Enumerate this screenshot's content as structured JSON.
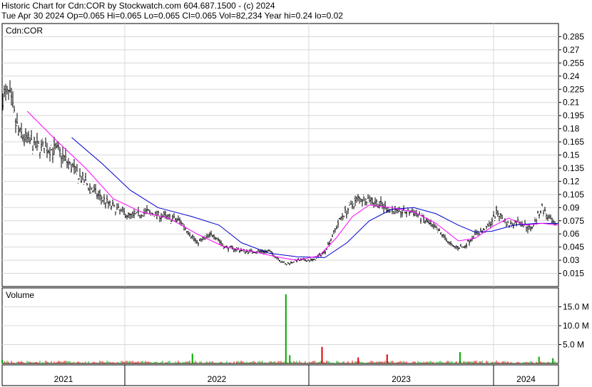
{
  "header": {
    "line1": "Historic Chart for Cdn:COR by Stockwatch.com 604.687.1500 - (c) 2024",
    "line2": "Tue Apr 30 2024  Op=0.065  Hi=0.065  Lo=0.065  Cl=0.065  Vol=82,234  Year hi=0.24  lo=0.02"
  },
  "colors": {
    "background": "#ffffff",
    "grid": "#d8d8d8",
    "price_bars": "#000000",
    "ma_short": "#ff00ff",
    "ma_long": "#0000cc",
    "volume_up": "#00aa00",
    "volume_down": "#dd0000"
  },
  "chart_data": [
    {
      "type": "ohlc",
      "symbol_label": "Cdn:COR",
      "ylim": [
        0.0,
        0.3
      ],
      "y_ticks": [
        "0.285",
        "0.27",
        "0.255",
        "0.24",
        "0.225",
        "0.21",
        "0.195",
        "0.18",
        "0.165",
        "0.15",
        "0.135",
        "0.12",
        "0.105",
        "0.09",
        "0.075",
        "0.06",
        "0.045",
        "0.03",
        "0.015"
      ],
      "x_labels": [
        "2021",
        "2022",
        "2023",
        "2024"
      ],
      "grid": true,
      "close_path": [
        [
          0.0,
          0.215
        ],
        [
          0.012,
          0.22
        ],
        [
          0.03,
          0.175
        ],
        [
          0.06,
          0.16
        ],
        [
          0.1,
          0.155
        ],
        [
          0.14,
          0.125
        ],
        [
          0.17,
          0.105
        ],
        [
          0.2,
          0.09
        ],
        [
          0.23,
          0.08
        ],
        [
          0.26,
          0.085
        ],
        [
          0.29,
          0.08
        ],
        [
          0.32,
          0.075
        ],
        [
          0.35,
          0.05
        ],
        [
          0.38,
          0.06
        ],
        [
          0.4,
          0.045
        ],
        [
          0.44,
          0.04
        ],
        [
          0.48,
          0.04
        ],
        [
          0.51,
          0.025
        ],
        [
          0.53,
          0.03
        ],
        [
          0.56,
          0.03
        ],
        [
          0.58,
          0.04
        ],
        [
          0.61,
          0.08
        ],
        [
          0.64,
          0.1
        ],
        [
          0.66,
          0.1
        ],
        [
          0.69,
          0.09
        ],
        [
          0.71,
          0.085
        ],
        [
          0.74,
          0.085
        ],
        [
          0.77,
          0.07
        ],
        [
          0.79,
          0.06
        ],
        [
          0.81,
          0.045
        ],
        [
          0.83,
          0.045
        ],
        [
          0.85,
          0.06
        ],
        [
          0.87,
          0.065
        ],
        [
          0.89,
          0.085
        ],
        [
          0.91,
          0.07
        ],
        [
          0.93,
          0.075
        ],
        [
          0.95,
          0.065
        ],
        [
          0.97,
          0.09
        ],
        [
          0.985,
          0.075
        ],
        [
          1.0,
          0.065
        ]
      ],
      "ma_short_path": [
        [
          0.045,
          0.2
        ],
        [
          0.1,
          0.165
        ],
        [
          0.15,
          0.135
        ],
        [
          0.2,
          0.1
        ],
        [
          0.25,
          0.085
        ],
        [
          0.3,
          0.078
        ],
        [
          0.35,
          0.06
        ],
        [
          0.4,
          0.045
        ],
        [
          0.45,
          0.04
        ],
        [
          0.5,
          0.033
        ],
        [
          0.53,
          0.03
        ],
        [
          0.57,
          0.035
        ],
        [
          0.6,
          0.055
        ],
        [
          0.63,
          0.08
        ],
        [
          0.66,
          0.093
        ],
        [
          0.7,
          0.09
        ],
        [
          0.74,
          0.085
        ],
        [
          0.78,
          0.072
        ],
        [
          0.82,
          0.052
        ],
        [
          0.85,
          0.055
        ],
        [
          0.88,
          0.068
        ],
        [
          0.91,
          0.078
        ],
        [
          0.94,
          0.07
        ],
        [
          0.97,
          0.072
        ],
        [
          1.0,
          0.07
        ]
      ],
      "ma_long_path": [
        [
          0.125,
          0.17
        ],
        [
          0.18,
          0.14
        ],
        [
          0.23,
          0.11
        ],
        [
          0.28,
          0.09
        ],
        [
          0.34,
          0.08
        ],
        [
          0.39,
          0.07
        ],
        [
          0.43,
          0.05
        ],
        [
          0.48,
          0.038
        ],
        [
          0.53,
          0.034
        ],
        [
          0.58,
          0.033
        ],
        [
          0.62,
          0.05
        ],
        [
          0.66,
          0.075
        ],
        [
          0.7,
          0.088
        ],
        [
          0.74,
          0.09
        ],
        [
          0.78,
          0.083
        ],
        [
          0.82,
          0.07
        ],
        [
          0.85,
          0.062
        ],
        [
          0.88,
          0.063
        ],
        [
          0.92,
          0.07
        ],
        [
          0.96,
          0.072
        ],
        [
          1.0,
          0.072
        ]
      ]
    },
    {
      "type": "bar",
      "label": "Volume",
      "ylim": [
        0,
        20
      ],
      "y_ticks": [
        "15.0 M",
        "10.0 M",
        "5.0 M"
      ],
      "spikes": [
        {
          "x": 0.51,
          "value": 18.3
        },
        {
          "x": 0.575,
          "value": 4.4
        },
        {
          "x": 0.517,
          "value": 2.2
        },
        {
          "x": 0.342,
          "value": 2.6
        },
        {
          "x": 0.692,
          "value": 2.4
        },
        {
          "x": 0.823,
          "value": 3.0
        },
        {
          "x": 0.965,
          "value": 1.8
        },
        {
          "x": 0.64,
          "value": 1.6
        },
        {
          "x": 0.0,
          "value": 1.0
        },
        {
          "x": 0.99,
          "value": 1.4
        }
      ]
    }
  ]
}
